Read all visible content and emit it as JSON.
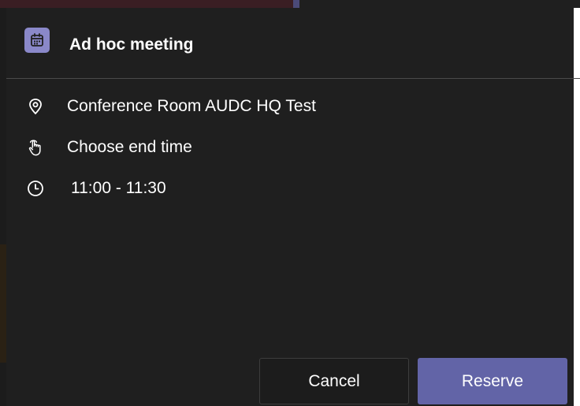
{
  "dialog": {
    "title": "Ad hoc meeting",
    "header_icon": "calendar-icon",
    "details": {
      "location": {
        "icon": "location-pin-icon",
        "text": "Conference Room AUDC HQ Test"
      },
      "end_time": {
        "icon": "touch-hand-icon",
        "text": "Choose end time"
      },
      "time_range": {
        "icon": "clock-icon",
        "text": "11:00 - 11:30"
      }
    },
    "buttons": {
      "cancel_label": "Cancel",
      "reserve_label": "Reserve"
    }
  },
  "colors": {
    "dialog_background": "#1f1f1f",
    "accent": "#6264a7",
    "header_icon_background": "#8a88c9",
    "divider": "#4a4a4a",
    "text": "#ffffff"
  }
}
